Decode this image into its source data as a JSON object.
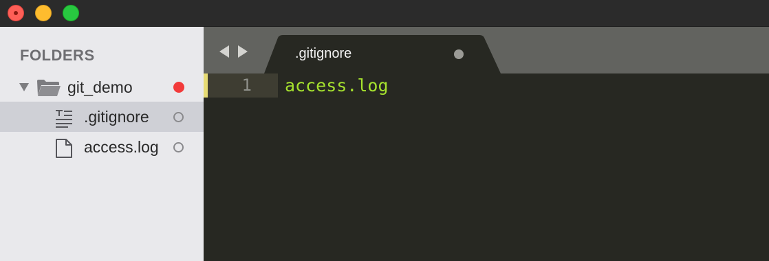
{
  "sidebar": {
    "header": "FOLDERS",
    "folder": {
      "name": "git_demo",
      "icon": "folder-open-icon",
      "status": "modified",
      "status_color": "#f23a3a"
    },
    "files": [
      {
        "name": ".gitignore",
        "icon": "text-file-icon",
        "selected": true,
        "status": "open"
      },
      {
        "name": "access.log",
        "icon": "file-icon",
        "selected": false,
        "status": "open"
      }
    ]
  },
  "tabs": [
    {
      "label": ".gitignore",
      "active": true,
      "dirty": true
    }
  ],
  "navigation": {
    "back_icon": "chevron-left-icon",
    "forward_icon": "chevron-right-icon"
  },
  "editor": {
    "lines": [
      {
        "number": "1",
        "text": "access.log"
      }
    ]
  },
  "colors": {
    "code_text": "#a6e22e",
    "editor_bg": "#272822",
    "sidebar_bg": "#e9e9ec",
    "gutter_marker": "#e6db74"
  }
}
